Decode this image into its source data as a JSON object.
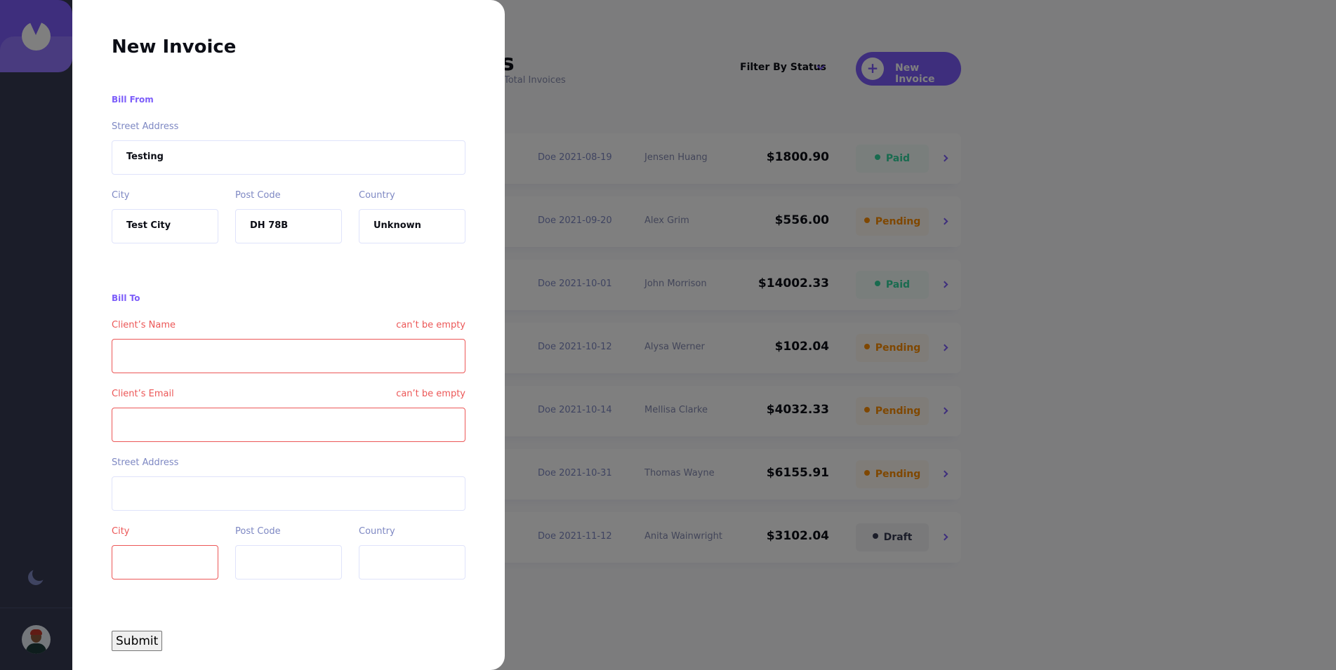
{
  "main": {
    "title": "Invoices",
    "title_visible": "ces",
    "subtitle": "Total Invoices",
    "filter_label": "Filter By Status",
    "new_button_label": "New Invoice",
    "new_button_plus": "+",
    "invoices": [
      {
        "id": "0",
        "due": "Doe 2021-08-19",
        "client": "Jensen Huang",
        "amount": "$1800.90",
        "status": "Paid",
        "status_type": "paid"
      },
      {
        "id": "",
        "due": "Doe 2021-09-20",
        "client": "Alex Grim",
        "amount": "$556.00",
        "status": "Pending",
        "status_type": "pending"
      },
      {
        "id": "3",
        "due": "Doe 2021-10-01",
        "client": "John Morrison",
        "amount": "$14002.33",
        "status": "Paid",
        "status_type": "paid"
      },
      {
        "id": "0",
        "due": "Doe 2021-10-12",
        "client": "Alysa Werner",
        "amount": "$102.04",
        "status": "Pending",
        "status_type": "pending"
      },
      {
        "id": "9",
        "due": "Doe 2021-10-14",
        "client": "Mellisa Clarke",
        "amount": "$4032.33",
        "status": "Pending",
        "status_type": "pending"
      },
      {
        "id": "",
        "due": "Doe 2021-10-31",
        "client": "Thomas Wayne",
        "amount": "$6155.91",
        "status": "Pending",
        "status_type": "pending"
      },
      {
        "id": "3",
        "due": "Doe 2021-11-12",
        "client": "Anita Wainwright",
        "amount": "$3102.04",
        "status": "Draft",
        "status_type": "draft"
      }
    ]
  },
  "form": {
    "title": "New Invoice",
    "bill_from": {
      "heading": "Bill From",
      "street_label": "Street Address",
      "street_value": "Testing",
      "city_label": "City",
      "city_value": "Test City",
      "postcode_label": "Post Code",
      "postcode_value": "DH 78B",
      "country_label": "Country",
      "country_value": "Unknown"
    },
    "bill_to": {
      "heading": "Bill To",
      "client_name_label": "Client’s Name",
      "client_name_error": "can’t be empty",
      "client_email_label": "Client’s Email",
      "client_email_error": "can’t be empty",
      "street_label": "Street Address",
      "city_label": "City",
      "postcode_label": "Post Code",
      "country_label": "Country"
    },
    "submit_label": "Submit"
  },
  "colors": {
    "accent": "#7c5dfa",
    "error": "#ec5757",
    "sidebar": "#373b53"
  },
  "icons": {
    "logo": "logo-icon",
    "theme": "moon-icon",
    "filter": "chevron-down-icon",
    "row_arrow": "chevron-right-icon"
  }
}
